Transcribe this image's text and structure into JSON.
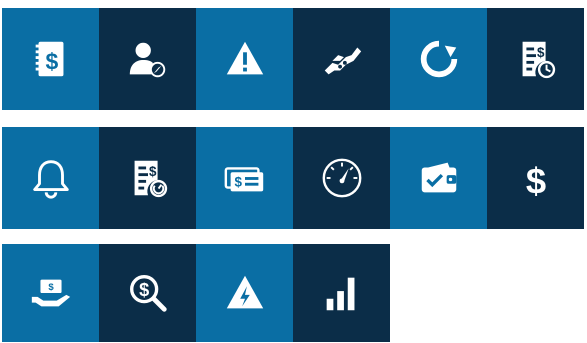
{
  "colors": {
    "light_tile": "#0a6ea4",
    "dark_tile": "#0b2d48",
    "icon": "#ffffff"
  },
  "rows": [
    [
      {
        "icon": "dollar-notebook-icon",
        "tone": "light"
      },
      {
        "icon": "user-compass-icon",
        "tone": "dark"
      },
      {
        "icon": "warning-icon",
        "tone": "light"
      },
      {
        "icon": "handshake-icon",
        "tone": "dark"
      },
      {
        "icon": "refresh-icon",
        "tone": "light"
      },
      {
        "icon": "bill-clock-icon",
        "tone": "dark"
      }
    ],
    [
      {
        "icon": "bell-icon",
        "tone": "light"
      },
      {
        "icon": "bill-clock-icon",
        "tone": "dark"
      },
      {
        "icon": "cash-stack-icon",
        "tone": "light"
      },
      {
        "icon": "speedometer-icon",
        "tone": "dark"
      },
      {
        "icon": "wallet-check-icon",
        "tone": "light"
      },
      {
        "icon": "dollar-icon",
        "tone": "dark"
      }
    ],
    [
      {
        "icon": "hand-cash-icon",
        "tone": "light"
      },
      {
        "icon": "dollar-search-icon",
        "tone": "dark"
      },
      {
        "icon": "electric-hazard-icon",
        "tone": "light"
      },
      {
        "icon": "bar-chart-icon",
        "tone": "dark"
      }
    ]
  ]
}
